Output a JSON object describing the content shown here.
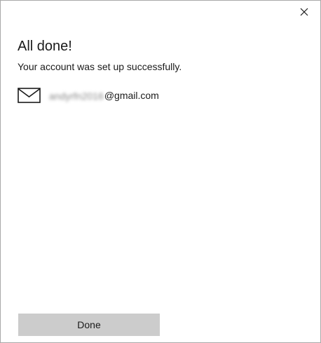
{
  "dialog": {
    "title": "All done!",
    "subtitle": "Your account was set up successfully."
  },
  "account": {
    "icon": "mail-icon",
    "email_user": "andyrfn2016",
    "email_domain": "@gmail.com"
  },
  "footer": {
    "done_label": "Done"
  },
  "colors": {
    "background": "#ffffff",
    "text": "#1a1a1a",
    "button_bg": "#cccccc",
    "window_border": "#a9a9a9"
  }
}
